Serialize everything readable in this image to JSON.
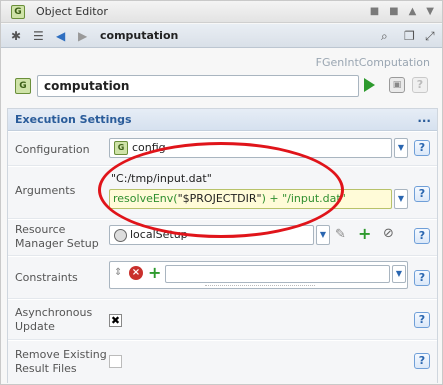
{
  "window": {
    "title": "Object Editor"
  },
  "toolbar": {
    "object_title": "computation"
  },
  "header": {
    "type_label": "FGenIntComputation",
    "name_value": "computation"
  },
  "section": {
    "title": "Execution Settings",
    "more": "...",
    "help": "?",
    "rows": {
      "configuration": {
        "label": "Configuration",
        "value": "config"
      },
      "arguments": {
        "label": "Arguments",
        "resolved_value": "\"C:/tmp/input.dat\"",
        "expr_fn": "resolveEnv(",
        "expr_str": "\"$PROJECTDIR\"",
        "expr_tail": ") + \"/input.dat\""
      },
      "resource_manager": {
        "label_line1": "Resource",
        "label_line2": "Manager Setup",
        "value": "localSetup"
      },
      "constraints": {
        "label": "Constraints"
      },
      "async_update": {
        "label_line1": "Asynchronous",
        "label_line2": "Update",
        "checked": true
      },
      "remove_results": {
        "label_line1": "Remove Existing",
        "label_line2": "Result Files",
        "checked": false
      }
    }
  },
  "colors": {
    "section_title": "#2a5c9a",
    "run": "#2d9a2d",
    "highlight": "#e0141a"
  }
}
